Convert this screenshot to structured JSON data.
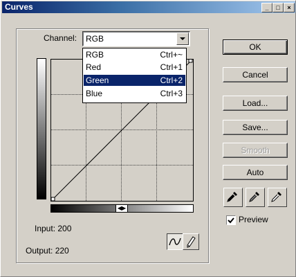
{
  "window": {
    "title": "Curves",
    "controls": [
      "_",
      "□",
      "×"
    ]
  },
  "channel": {
    "label": "Channel:",
    "selected": "RGB"
  },
  "dropdown": {
    "options": [
      {
        "name": "RGB",
        "shortcut": "Ctrl+~"
      },
      {
        "name": "Red",
        "shortcut": "Ctrl+1"
      },
      {
        "name": "Green",
        "shortcut": "Ctrl+2"
      },
      {
        "name": "Blue",
        "shortcut": "Ctrl+3"
      }
    ],
    "highlighted": "Green"
  },
  "buttons": {
    "ok": "OK",
    "cancel": "Cancel",
    "load": "Load...",
    "save": "Save...",
    "smooth": "Smooth",
    "auto": "Auto"
  },
  "preview": {
    "label": "Preview",
    "checked": true
  },
  "readout": {
    "input": "Input: 200",
    "output": "Output: 220"
  },
  "icons": {
    "eyedroppers": [
      "black-point-eyedropper-icon",
      "gray-point-eyedropper-icon",
      "white-point-eyedropper-icon"
    ],
    "tools": [
      "curve-tool-icon",
      "pencil-tool-icon"
    ]
  },
  "colors": {
    "title_start": "#0a246a",
    "title_end": "#a6caf0",
    "highlight": "#0a246a"
  }
}
